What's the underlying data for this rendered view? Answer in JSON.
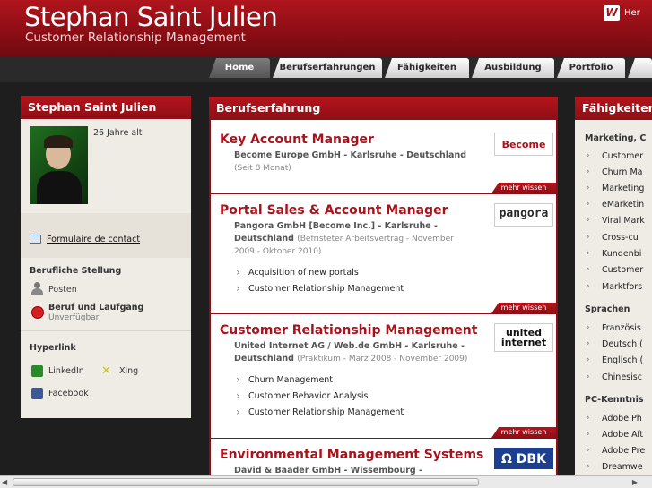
{
  "site": {
    "title": "Stephan Saint Julien",
    "subtitle": "Customer Relationship Management",
    "lang_icon": "W",
    "lang_label": "Her"
  },
  "nav": [
    "Home",
    "Berufserfahrungen",
    "Fähigkeiten",
    "Ausbildung",
    "Portfolio"
  ],
  "left": {
    "head": "Stephan Saint Julien",
    "age": "26 Jahre alt",
    "contact": "Formulaire de contact",
    "pos_head": "Berufliche Stellung",
    "posten": "Posten",
    "beruf": "Beruf und Laufgang",
    "beruf_status": "Unverfügbar",
    "hyper_head": "Hyperlink",
    "linkedin": "LinkedIn",
    "xing": "Xing",
    "facebook": "Facebook"
  },
  "main": {
    "head": "Berufserfahrung",
    "more": "mehr wissen",
    "jobs": [
      {
        "title": "Key Account Manager",
        "company": "Become Europe GmbH - Karlsruhe - Deutschland",
        "detail": "(Seit 8 Monat)",
        "logo": "Become",
        "bullets": []
      },
      {
        "title": "Portal Sales & Account Manager",
        "company": "Pangora GmbH [Become Inc.] - Karlsruhe - Deutschland",
        "detail": "(Befristeter Arbeitsvertrag - November 2009 - Oktober 2010)",
        "logo": "pangora",
        "bullets": [
          "Acquisition of new portals",
          "Customer Relationship Management"
        ]
      },
      {
        "title": "Customer Relationship Management",
        "company": "United Internet AG / Web.de GmbH - Karlsruhe - Deutschland",
        "detail": "(Praktikum - März 2008 - November 2009)",
        "logo": "united internet",
        "bullets": [
          "Churn Management",
          "Customer Behavior Analysis",
          "Customer Relationship Management"
        ]
      },
      {
        "title": "Environmental Management Systems",
        "company": "David & Baader GmbH - Wissembourg -",
        "detail": "",
        "logo": "Ω DBK",
        "bullets": []
      }
    ]
  },
  "right": {
    "head": "Fähigkeiten",
    "sec1": "Marketing, C",
    "items1": [
      "Customer",
      "Churn Ma",
      "Marketing",
      "eMarketin",
      "Viral Mark",
      "Cross-cu",
      "Kundenbi",
      "Customer",
      "Marktfors"
    ],
    "sec2": "Sprachen",
    "items2": [
      "Französis",
      "Deutsch (",
      "Englisch (",
      "Chinesisc"
    ],
    "sec3": "PC-Kenntnis",
    "items3": [
      "Adobe Ph",
      "Adobe Aft",
      "Adobe Pre",
      "Dreamwe"
    ]
  }
}
